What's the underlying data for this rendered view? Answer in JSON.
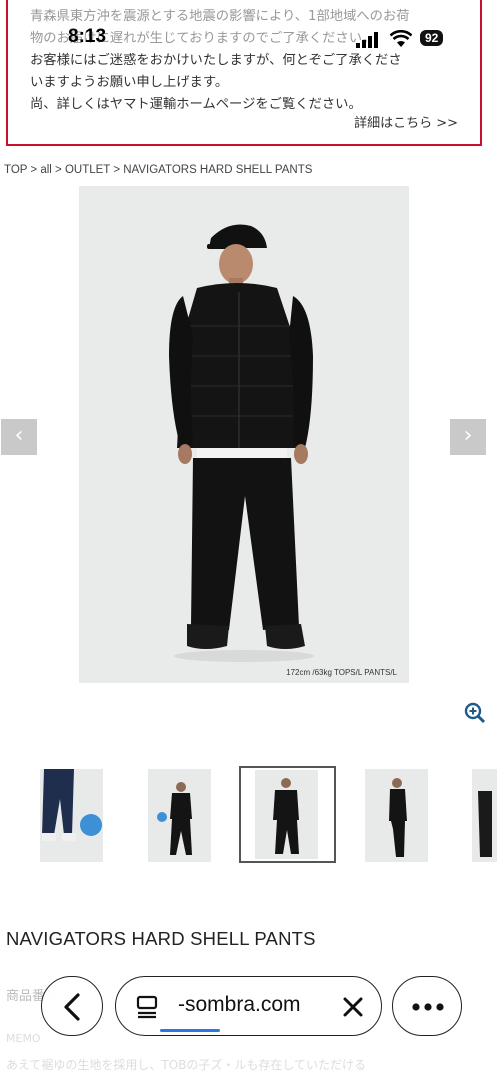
{
  "notice": {
    "lines": [
      "青森県東方沖を震源とする地震の影響により、1部地域へのお荷",
      "物のお届けに遅れが生じておりますのでご了承ください。",
      "お客様にはご迷惑をおかけいたしますが、何とぞご了承くださ",
      "いますようお願い申し上げます。",
      "尚、詳しくはヤマト運輸ホームページをご覧ください。"
    ],
    "detail_link": "詳細はこちら >>"
  },
  "status_bar": {
    "time": "8:13",
    "battery": "92"
  },
  "breadcrumb": {
    "items": [
      "TOP",
      "all",
      "OUTLET",
      "NAVIGATORS HARD SHELL PANTS"
    ],
    "separator": " > "
  },
  "gallery": {
    "caption": "172cm /63kg TOPS/L PANTS/L",
    "prev": "‹",
    "next": "›"
  },
  "product": {
    "title": "NAVIGATORS HARD SHELL PANTS",
    "number_label": "商品番号",
    "sub_label": "MEMO",
    "desc_fragment": "あえて裾ゆの生地を採用し、TOBの子ズ・ルも存在していただける"
  },
  "browser": {
    "url": "-sombra.com",
    "back_icon": "chevron-left-icon",
    "close_icon": "close-icon",
    "more_icon": "more-icon"
  },
  "colors": {
    "notice_border": "#c8102e",
    "accent_blue": "#2a78e4",
    "image_bg": "#e9ebea"
  }
}
